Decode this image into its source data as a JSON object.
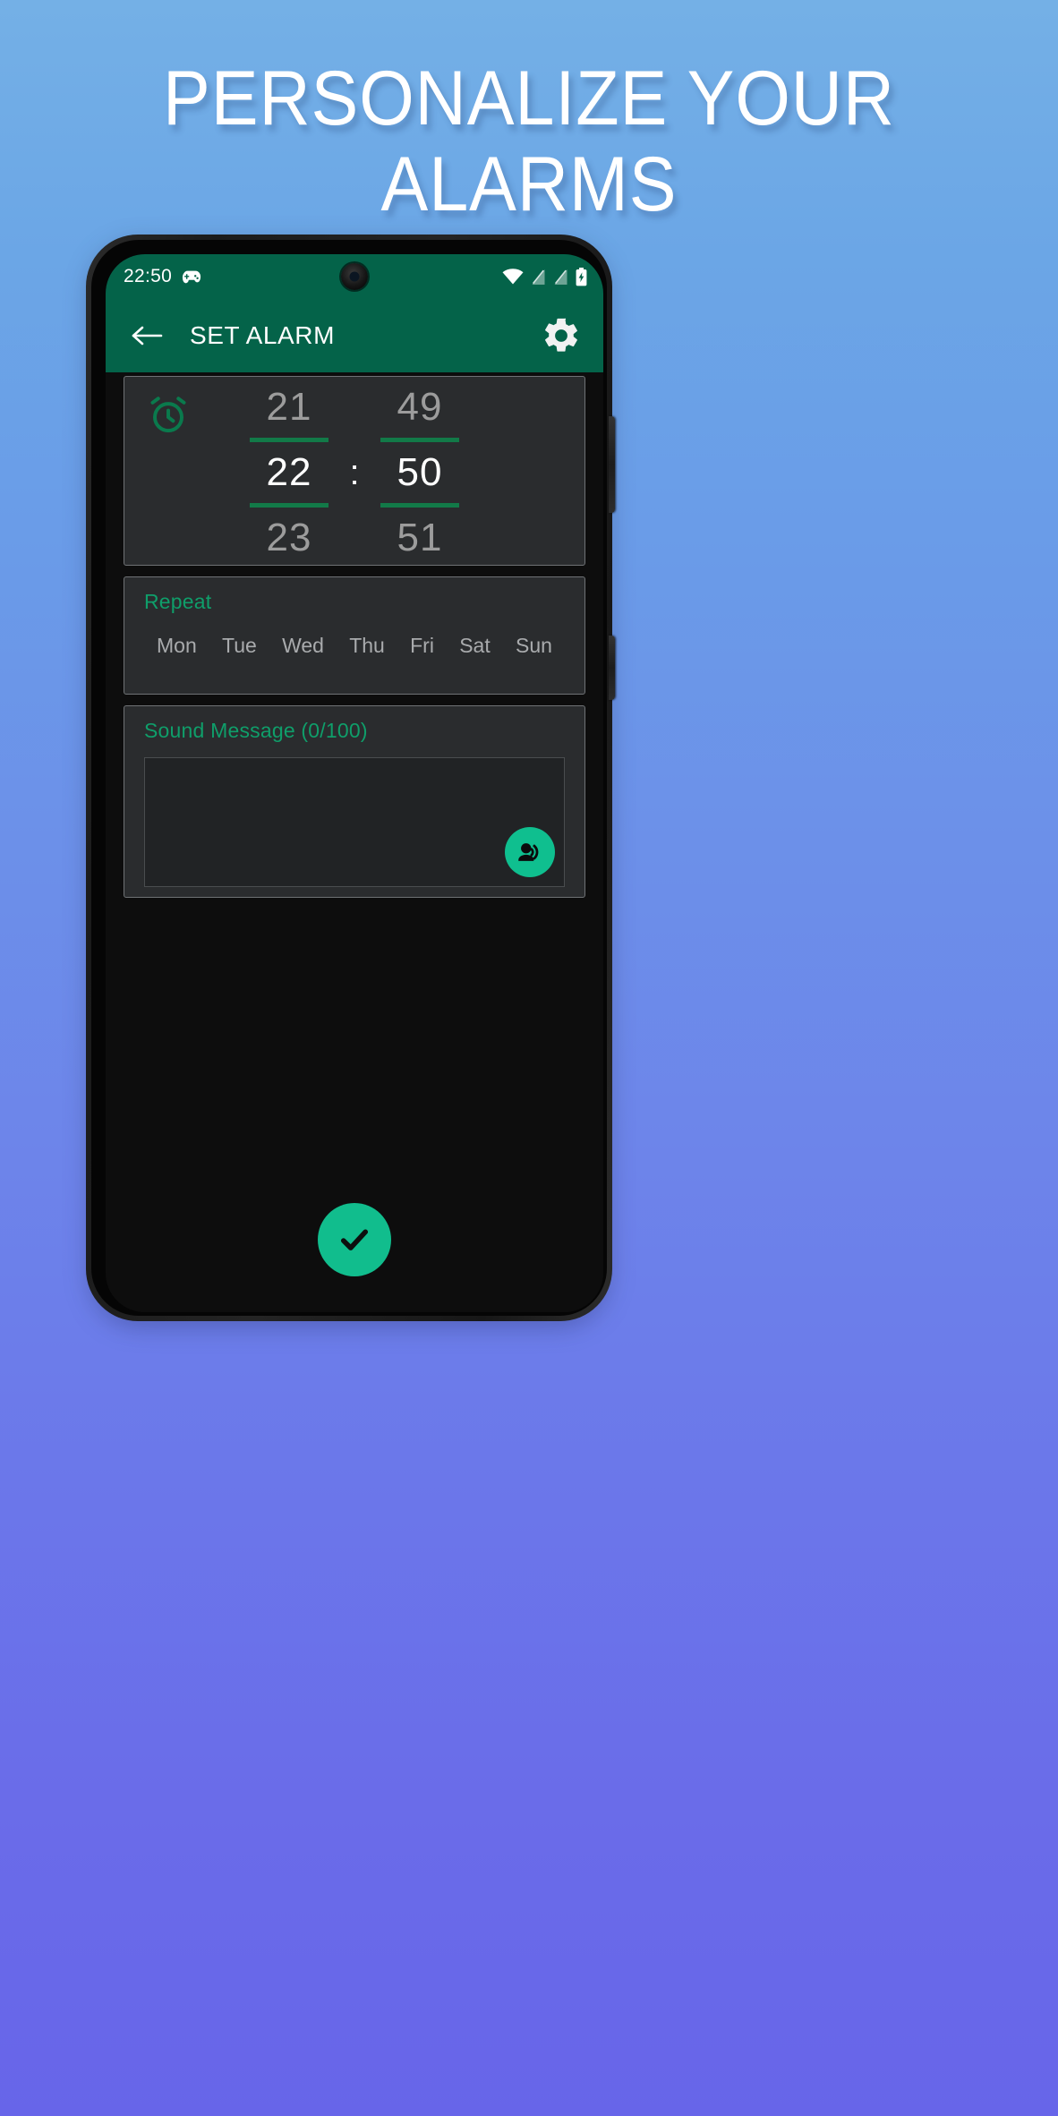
{
  "promo": {
    "headline_line1": "PERSONALIZE YOUR",
    "headline_line2": "ALARMS",
    "headline_color": "#ffffff",
    "bg_gradient_top": "#74b0e6",
    "bg_gradient_bottom": "#6765e9"
  },
  "status_bar": {
    "clock": "22:50",
    "icons": [
      "gamepad-icon",
      "wifi-icon",
      "signal-icon",
      "signal-icon",
      "battery-charging-icon"
    ],
    "background": "#046349"
  },
  "app_bar": {
    "back_label": "back-arrow",
    "title": "SET ALARM",
    "settings_label": "Settings",
    "background": "#046349"
  },
  "time_picker": {
    "icon": "alarm-clock-icon",
    "accent": "#127a48",
    "hours": {
      "prev": "21",
      "selected": "22",
      "next": "23"
    },
    "minutes": {
      "prev": "49",
      "selected": "50",
      "next": "51"
    },
    "separator": ":"
  },
  "repeat": {
    "label": "Repeat",
    "label_color": "#0f9e6a",
    "days": [
      "Mon",
      "Tue",
      "Wed",
      "Thu",
      "Fri",
      "Sat",
      "Sun"
    ],
    "selected_days": []
  },
  "sound_message": {
    "label": "Sound Message  (0/100)",
    "label_color": "#0f9e6a",
    "value": "",
    "placeholder": "",
    "char_count": "0",
    "char_limit": "100",
    "tts_button": "record-voice-over-icon",
    "tts_color": "#0fbf8f"
  },
  "confirm": {
    "label": "confirm",
    "icon": "check-icon",
    "color": "#11bd8d"
  }
}
